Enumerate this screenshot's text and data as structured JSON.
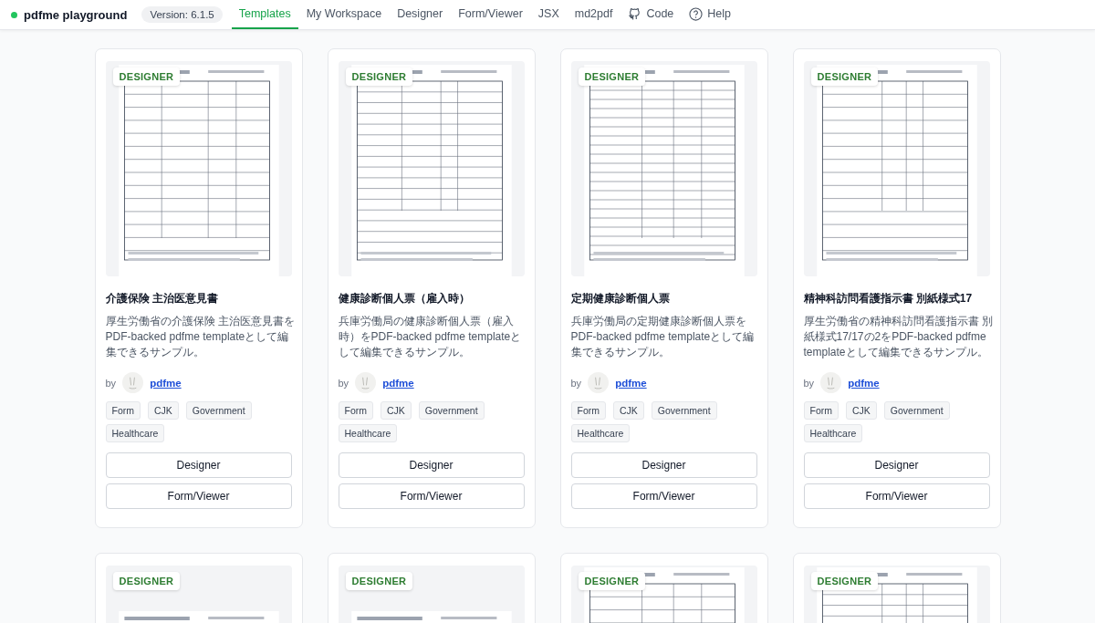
{
  "header": {
    "brand": "pdfme playground",
    "version": "Version: 6.1.5",
    "tabs": [
      {
        "label": "Templates",
        "selected": true,
        "kind": "plain"
      },
      {
        "label": "My Workspace",
        "selected": false,
        "kind": "plain"
      },
      {
        "label": "Designer",
        "selected": false,
        "kind": "plain"
      },
      {
        "label": "Form/Viewer",
        "selected": false,
        "kind": "plain"
      },
      {
        "label": "JSX",
        "selected": false,
        "kind": "plain"
      },
      {
        "label": "md2pdf",
        "selected": false,
        "kind": "plain"
      },
      {
        "label": "Code",
        "selected": false,
        "kind": "repo"
      },
      {
        "label": "Help",
        "selected": false,
        "kind": "help"
      }
    ]
  },
  "cards": [
    {
      "badge": "DESIGNER",
      "title": "介護保険 主治医意見書",
      "description": "厚生労働省の介護保険 主治医意見書をPDF-backed pdfme templateとして編集できるサンプル。",
      "by": "by",
      "author": "pdfme",
      "tags": [
        "Form",
        "CJK",
        "Government",
        "Healthcare"
      ],
      "buttons": [
        "Designer",
        "Form/Viewer"
      ]
    },
    {
      "badge": "DESIGNER",
      "title": "健康診断個人票（雇入時）",
      "description": "兵庫労働局の健康診断個人票（雇入時）をPDF-backed pdfme templateとして編集できるサンプル。",
      "by": "by",
      "author": "pdfme",
      "tags": [
        "Form",
        "CJK",
        "Government",
        "Healthcare"
      ],
      "buttons": [
        "Designer",
        "Form/Viewer"
      ]
    },
    {
      "badge": "DESIGNER",
      "title": "定期健康診断個人票",
      "description": "兵庫労働局の定期健康診断個人票をPDF-backed pdfme templateとして編集できるサンプル。",
      "by": "by",
      "author": "pdfme",
      "tags": [
        "Form",
        "CJK",
        "Government",
        "Healthcare"
      ],
      "buttons": [
        "Designer",
        "Form/Viewer"
      ]
    },
    {
      "badge": "DESIGNER",
      "title": "精神科訪問看護指示書 別紙様式17",
      "description": "厚生労働省の精神科訪問看護指示書 別紙様式17/17の2をPDF-backed pdfme templateとして編集できるサンプル。",
      "by": "by",
      "author": "pdfme",
      "tags": [
        "Form",
        "CJK",
        "Government",
        "Healthcare"
      ],
      "buttons": [
        "Designer",
        "Form/Viewer"
      ]
    },
    {
      "badge": "DESIGNER"
    },
    {
      "badge": "DESIGNER"
    },
    {
      "badge": "DESIGNER"
    },
    {
      "badge": "DESIGNER"
    }
  ]
}
